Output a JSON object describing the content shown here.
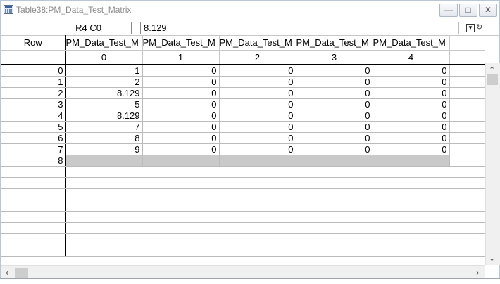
{
  "window": {
    "title": "Table38:PM_Data_Test_Matrix"
  },
  "toolbar": {
    "cell_ref": "R4 C0",
    "cell_value": "8.129"
  },
  "columns": [
    {
      "name": "Row",
      "index": ""
    },
    {
      "name": "PM_Data_Test_M",
      "index": "0"
    },
    {
      "name": "PM_Data_Test_M",
      "index": "1"
    },
    {
      "name": "PM_Data_Test_M",
      "index": "2"
    },
    {
      "name": "PM_Data_Test_M",
      "index": "3"
    },
    {
      "name": "PM_Data_Test_M",
      "index": "4"
    }
  ],
  "rows": [
    [
      "0",
      "1",
      "0",
      "0",
      "0",
      "0"
    ],
    [
      "1",
      "2",
      "0",
      "0",
      "0",
      "0"
    ],
    [
      "2",
      "8.129",
      "0",
      "0",
      "0",
      "0"
    ],
    [
      "3",
      "5",
      "0",
      "0",
      "0",
      "0"
    ],
    [
      "4",
      "8.129",
      "0",
      "0",
      "0",
      "0"
    ],
    [
      "5",
      "7",
      "0",
      "0",
      "0",
      "0"
    ],
    [
      "6",
      "8",
      "0",
      "0",
      "0",
      "0"
    ],
    [
      "7",
      "9",
      "0",
      "0",
      "0",
      "0"
    ]
  ],
  "new_row_label": "8",
  "icons": {
    "minimize": "minimize-icon",
    "maximize": "maximize-icon",
    "close": "close-icon",
    "dropdown": "dropdown-icon",
    "refresh": "refresh-icon"
  }
}
